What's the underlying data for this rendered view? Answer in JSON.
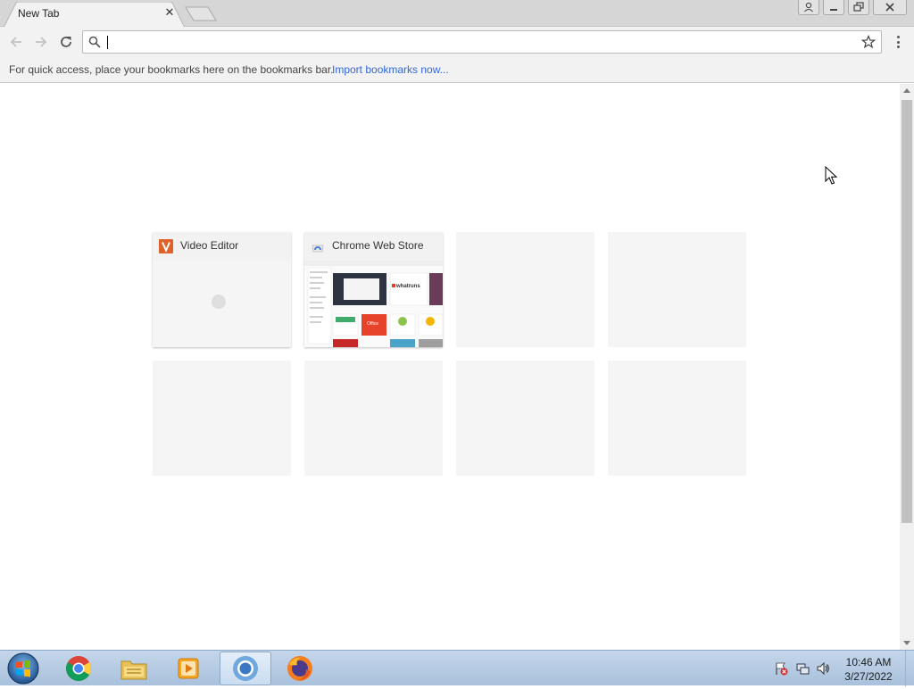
{
  "window": {
    "tab_title": "New Tab",
    "tab_close": "✕"
  },
  "omnibox": {
    "value": "",
    "placeholder": ""
  },
  "bookmarks_bar": {
    "message": "For quick access, place your bookmarks here on the bookmarks bar.",
    "import_link": "Import bookmarks now..."
  },
  "most_visited": [
    {
      "title": "Video Editor",
      "favicon": "v-letter-icon",
      "favicon_color": "#e0612a",
      "state": "loading"
    },
    {
      "title": "Chrome Web Store",
      "favicon": "chrome-web-store-icon",
      "state": "thumbnail"
    },
    {
      "title": "",
      "state": "empty"
    },
    {
      "title": "",
      "state": "empty"
    },
    {
      "title": "",
      "state": "empty"
    },
    {
      "title": "",
      "state": "empty"
    },
    {
      "title": "",
      "state": "empty"
    },
    {
      "title": "",
      "state": "empty"
    }
  ],
  "thumbnail_text": {
    "brand": "whatruns",
    "office": "Office"
  },
  "taskbar": {
    "items": [
      "start-orb-icon",
      "chrome-icon",
      "file-explorer-icon",
      "media-player-icon",
      "chromium-icon",
      "firefox-icon"
    ],
    "clock_time": "10:46 AM",
    "clock_date": "3/27/2022"
  },
  "colors": {
    "accent_link": "#3367d6",
    "tab_strip": "#d6d6d6",
    "toolbar": "#f2f2f2"
  }
}
